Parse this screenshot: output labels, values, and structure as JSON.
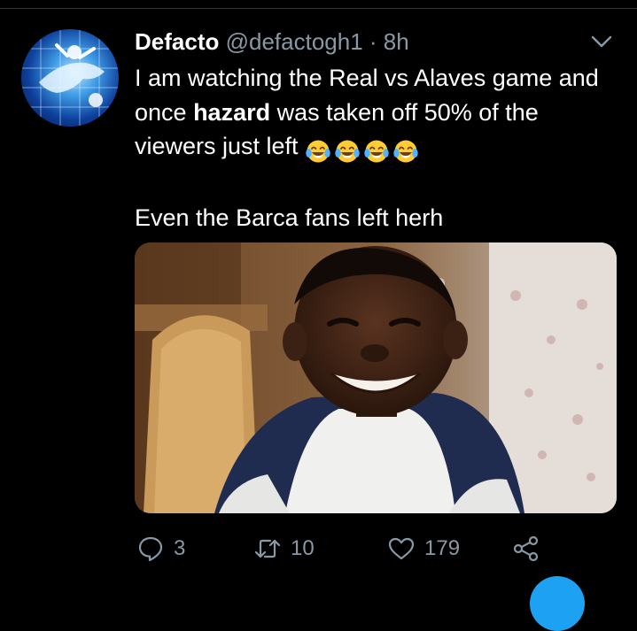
{
  "tweet": {
    "display_name": "Defacto",
    "handle": "@defactogh1",
    "separator": "·",
    "time": "8h",
    "text_part1": "I am watching the Real vs Alaves game and once ",
    "text_bold": "hazard",
    "text_part2": " was taken off 50% of the viewers just left",
    "emoji_name": "face-with-tears-of-joy",
    "emoji_count": 4,
    "text_paragraph2": "Even the Barca fans left herh"
  },
  "actions": {
    "reply_count": "3",
    "retweet_count": "10",
    "like_count": "179"
  },
  "colors": {
    "background": "#000000",
    "secondary_text": "#8899a6",
    "accent": "#1da1f2",
    "divider": "#2f3336"
  }
}
